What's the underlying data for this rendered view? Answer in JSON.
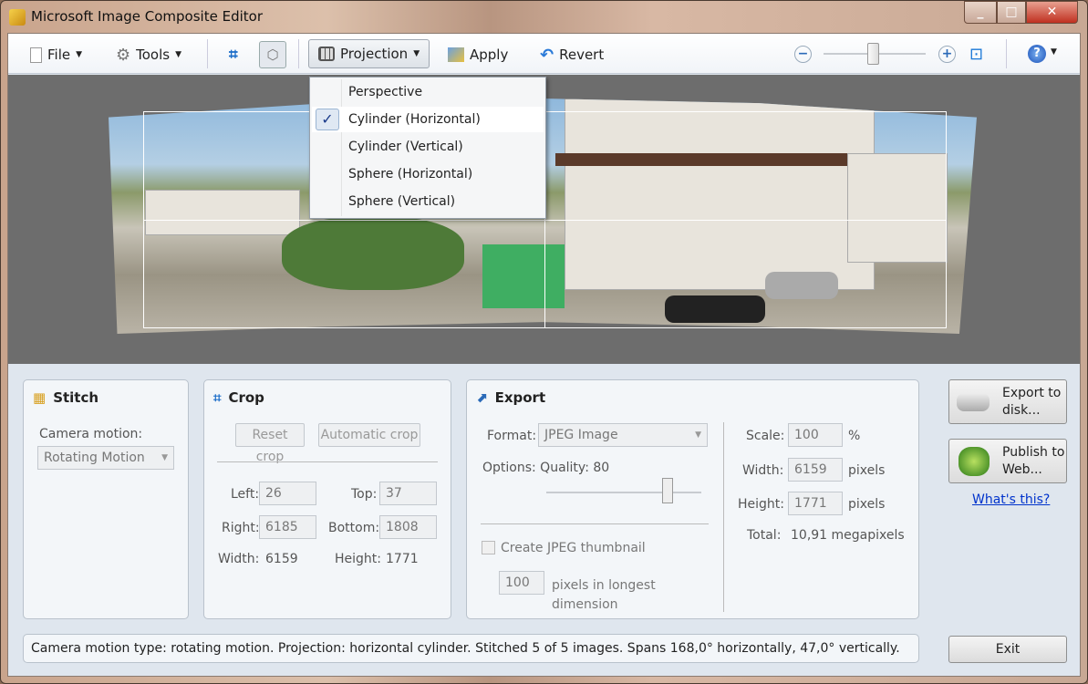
{
  "window": {
    "title": "Microsoft Image Composite Editor"
  },
  "toolbar": {
    "file": "File",
    "tools": "Tools",
    "projection": "Projection",
    "apply": "Apply",
    "revert": "Revert",
    "zoom_level": 0.33
  },
  "projection_menu": {
    "items": [
      {
        "label": "Perspective",
        "checked": false
      },
      {
        "label": "Cylinder (Horizontal)",
        "checked": true
      },
      {
        "label": "Cylinder (Vertical)",
        "checked": false
      },
      {
        "label": "Sphere (Horizontal)",
        "checked": false
      },
      {
        "label": "Sphere (Vertical)",
        "checked": false
      }
    ],
    "check": "✓"
  },
  "stitch": {
    "title": "Stitch",
    "camera_motion_label": "Camera motion:",
    "camera_motion_value": "Rotating Motion"
  },
  "crop": {
    "title": "Crop",
    "reset": "Reset crop",
    "automatic": "Automatic crop",
    "left_label": "Left:",
    "left": "26",
    "top_label": "Top:",
    "top": "37",
    "right_label": "Right:",
    "right": "6185",
    "bottom_label": "Bottom:",
    "bottom": "1808",
    "width_label": "Width:",
    "width": "6159",
    "height_label": "Height:",
    "height": "1771"
  },
  "export": {
    "title": "Export",
    "format_label": "Format:",
    "format_value": "JPEG Image",
    "options": "Options: Quality: 80",
    "quality": 80,
    "thumbnail_label": "Create JPEG thumbnail",
    "thumbnail_size": "100",
    "thumbnail_unit": "pixels in longest dimension",
    "scale_label": "Scale:",
    "scale": "100",
    "scale_unit": "%",
    "width_label": "Width:",
    "width": "6159",
    "height_label": "Height:",
    "height": "1771",
    "pixels": "pixels",
    "total_label": "Total:",
    "total": "10,91 megapixels"
  },
  "actions": {
    "export_disk": "Export to disk...",
    "publish_web": "Publish to Web...",
    "whats_this": "What's this?",
    "exit": "Exit"
  },
  "status": "Camera motion type: rotating motion. Projection: horizontal cylinder. Stitched 5 of 5 images. Spans 168,0° horizontally, 47,0° vertically."
}
